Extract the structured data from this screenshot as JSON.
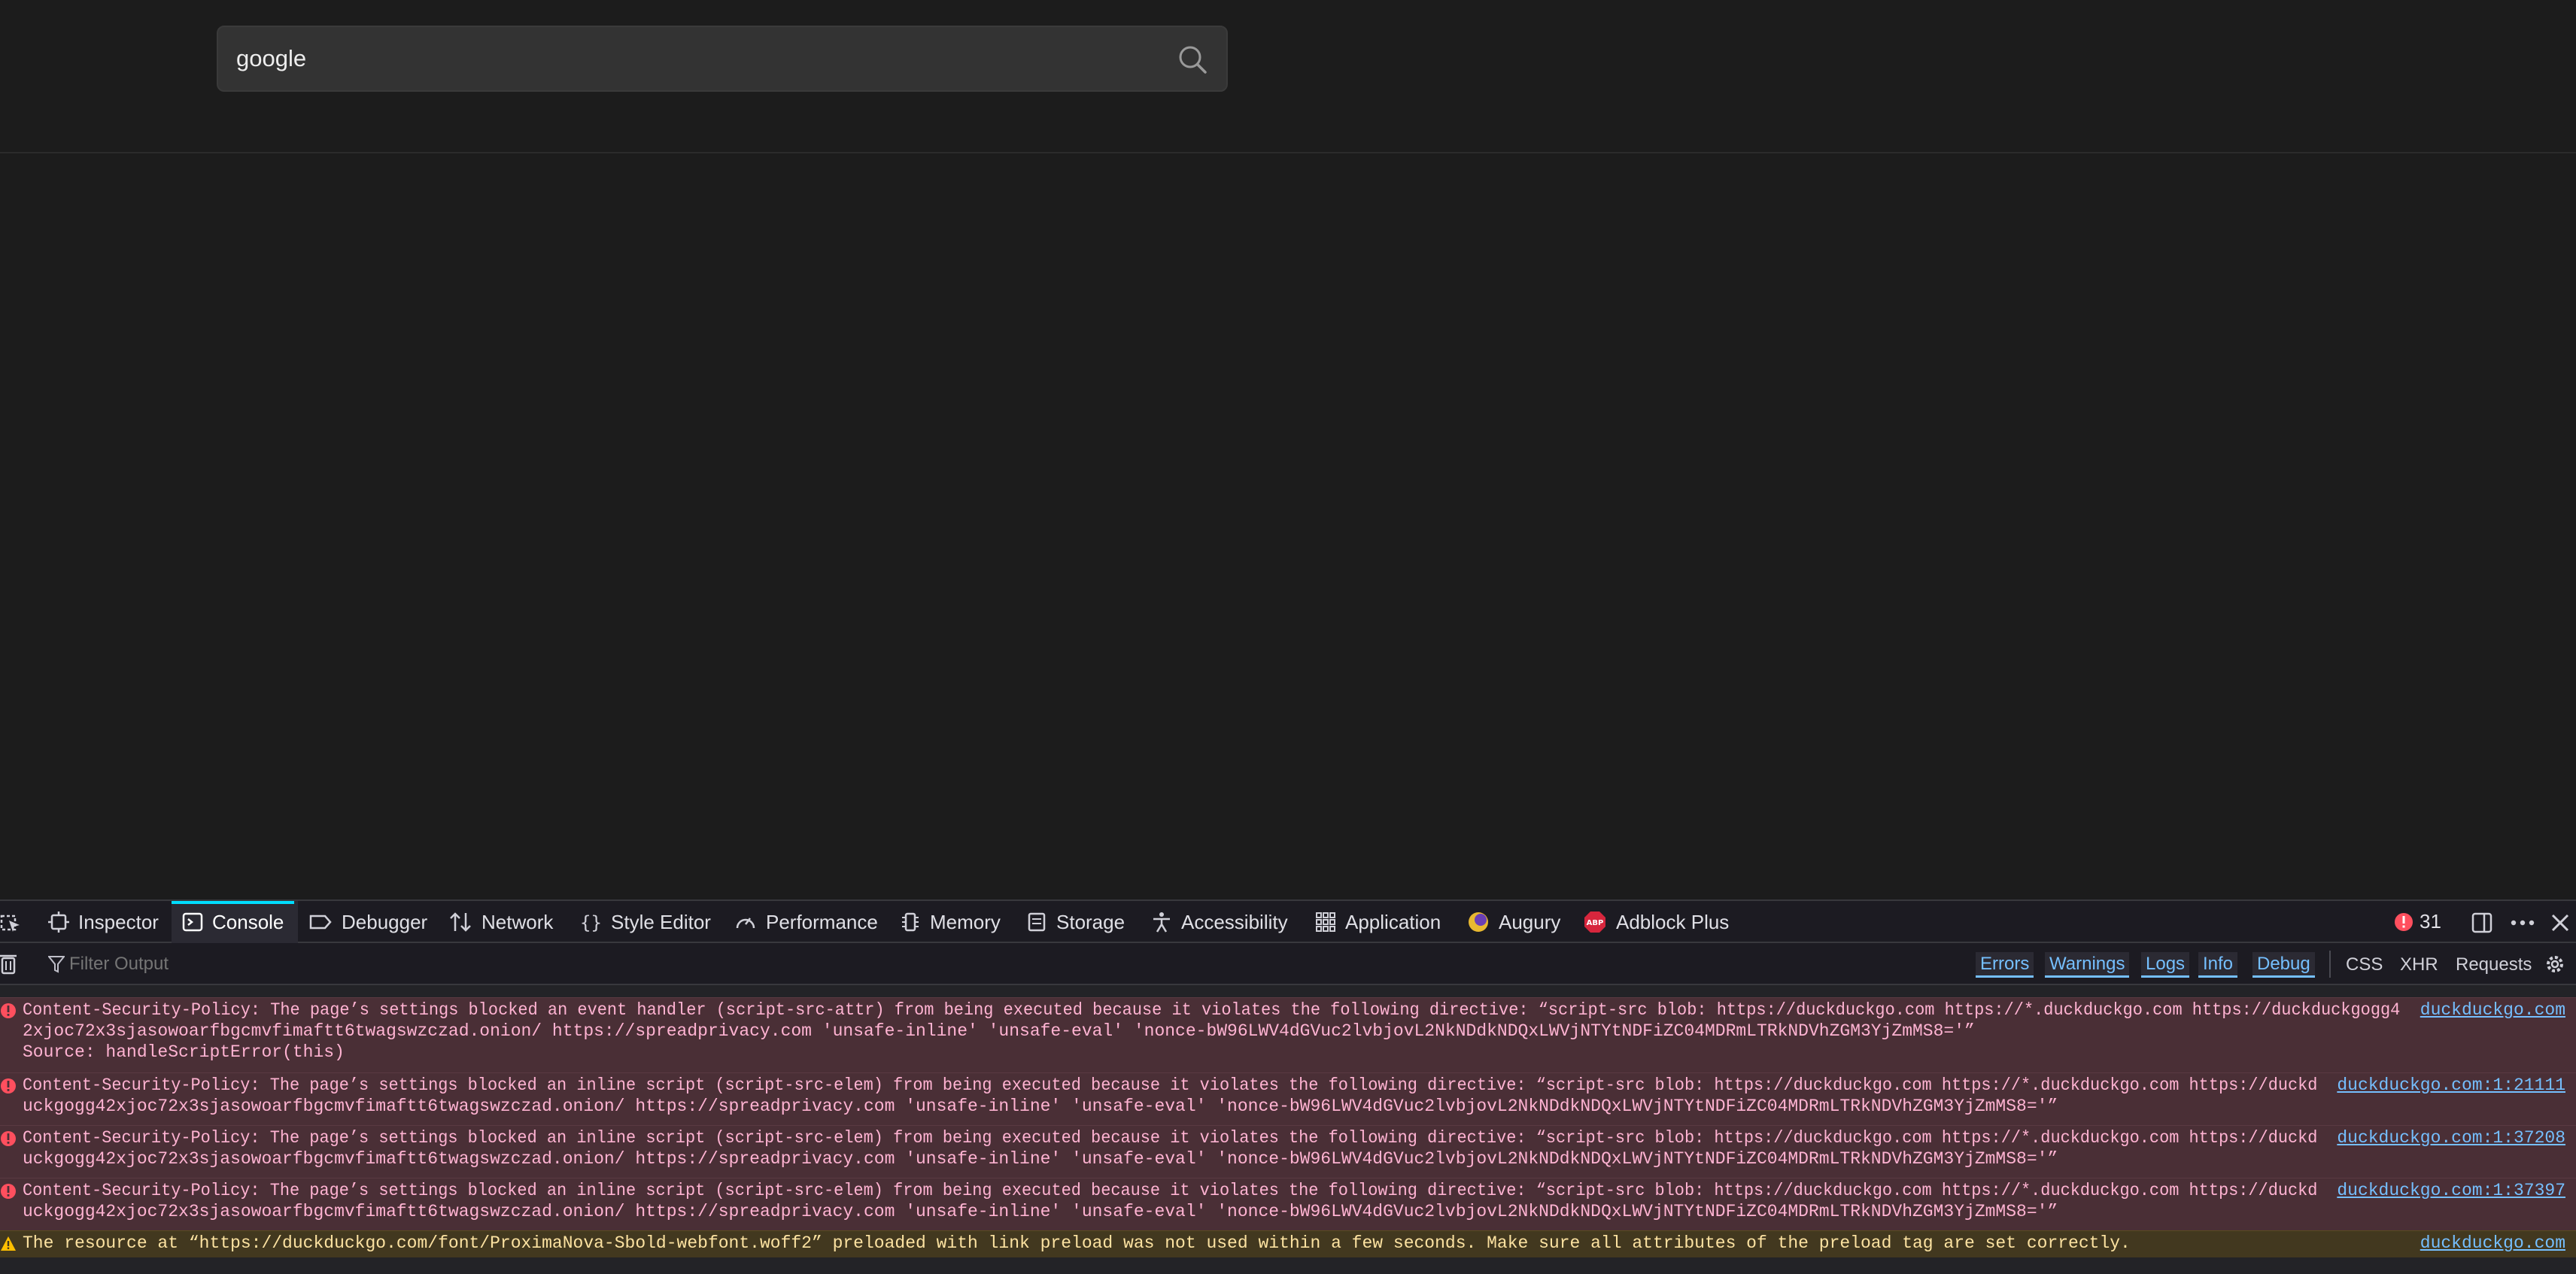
{
  "search": {
    "value": "google",
    "button_icon": "search-icon"
  },
  "devtools": {
    "tabs": [
      {
        "label": "Inspector",
        "icon": "inspector-icon"
      },
      {
        "label": "Console",
        "icon": "console-icon",
        "selected": true
      },
      {
        "label": "Debugger",
        "icon": "debugger-icon"
      },
      {
        "label": "Network",
        "icon": "network-icon"
      },
      {
        "label": "Style Editor",
        "icon": "style-editor-icon"
      },
      {
        "label": "Performance",
        "icon": "performance-icon"
      },
      {
        "label": "Memory",
        "icon": "memory-icon"
      },
      {
        "label": "Storage",
        "icon": "storage-icon"
      },
      {
        "label": "Accessibility",
        "icon": "accessibility-icon"
      },
      {
        "label": "Application",
        "icon": "application-icon"
      },
      {
        "label": "Augury",
        "icon": "augury-icon"
      },
      {
        "label": "Adblock Plus",
        "icon": "adblock-plus-icon"
      }
    ],
    "error_count": "31",
    "toolbar": {
      "filter_placeholder": "Filter Output",
      "levels": [
        "Errors",
        "Warnings",
        "Logs",
        "Info",
        "Debug"
      ],
      "net_filters": [
        "CSS",
        "XHR",
        "Requests"
      ]
    },
    "messages": [
      {
        "type": "error",
        "lines": [
          "Content-Security-Policy: The page’s settings blocked an event handler (script-src-attr) from being executed because it violates the following directive: “script-src blob: https://duckduckgo.com https://*.duckduckgo.com https://duckduckgogg4",
          "2xjoc72x3sjasowoarfbgcmvfimaftt6twagswzczad.onion/ https://spreadprivacy.com 'unsafe-inline' 'unsafe-eval' 'nonce-bW96LWV4dGVuc2lvbjovL2NkNDdkNDQxLWVjNTYtNDFiZC04MDRmLTRkNDVhZGM3YjZmMS8='”",
          "Source: handleScriptError(this)"
        ],
        "source": "duckduckgo.com"
      },
      {
        "type": "error",
        "lines": [
          "Content-Security-Policy: The page’s settings blocked an inline script (script-src-elem) from being executed because it violates the following directive: “script-src blob: https://duckduckgo.com https://*.duckduckgo.com https://duckd",
          "uckgogg42xjoc72x3sjasowoarfbgcmvfimaftt6twagswzczad.onion/ https://spreadprivacy.com 'unsafe-inline' 'unsafe-eval' 'nonce-bW96LWV4dGVuc2lvbjovL2NkNDdkNDQxLWVjNTYtNDFiZC04MDRmLTRkNDVhZGM3YjZmMS8='”"
        ],
        "source": "duckduckgo.com:1:21111"
      },
      {
        "type": "error",
        "lines": [
          "Content-Security-Policy: The page’s settings blocked an inline script (script-src-elem) from being executed because it violates the following directive: “script-src blob: https://duckduckgo.com https://*.duckduckgo.com https://duckd",
          "uckgogg42xjoc72x3sjasowoarfbgcmvfimaftt6twagswzczad.onion/ https://spreadprivacy.com 'unsafe-inline' 'unsafe-eval' 'nonce-bW96LWV4dGVuc2lvbjovL2NkNDdkNDQxLWVjNTYtNDFiZC04MDRmLTRkNDVhZGM3YjZmMS8='”"
        ],
        "source": "duckduckgo.com:1:37208"
      },
      {
        "type": "error",
        "lines": [
          "Content-Security-Policy: The page’s settings blocked an inline script (script-src-elem) from being executed because it violates the following directive: “script-src blob: https://duckduckgo.com https://*.duckduckgo.com https://duckd",
          "uckgogg42xjoc72x3sjasowoarfbgcmvfimaftt6twagswzczad.onion/ https://spreadprivacy.com 'unsafe-inline' 'unsafe-eval' 'nonce-bW96LWV4dGVuc2lvbjovL2NkNDdkNDQxLWVjNTYtNDFiZC04MDRmLTRkNDVhZGM3YjZmMS8='”"
        ],
        "source": "duckduckgo.com:1:37397"
      },
      {
        "type": "warn",
        "lines": [
          "The resource at “https://duckduckgo.com/font/ProximaNova-Sbold-webfont.woff2” preloaded with link preload was not used within a few seconds. Make sure all attributes of the preload tag are set correctly."
        ],
        "source": "duckduckgo.com"
      }
    ]
  },
  "colors": {
    "accent": "#00ddff",
    "link": "#75bfff",
    "error_bg": "#4a2f36",
    "error_text": "#ffb3d2",
    "warn_bg": "#42381f",
    "warn_text": "#fce2a1"
  }
}
